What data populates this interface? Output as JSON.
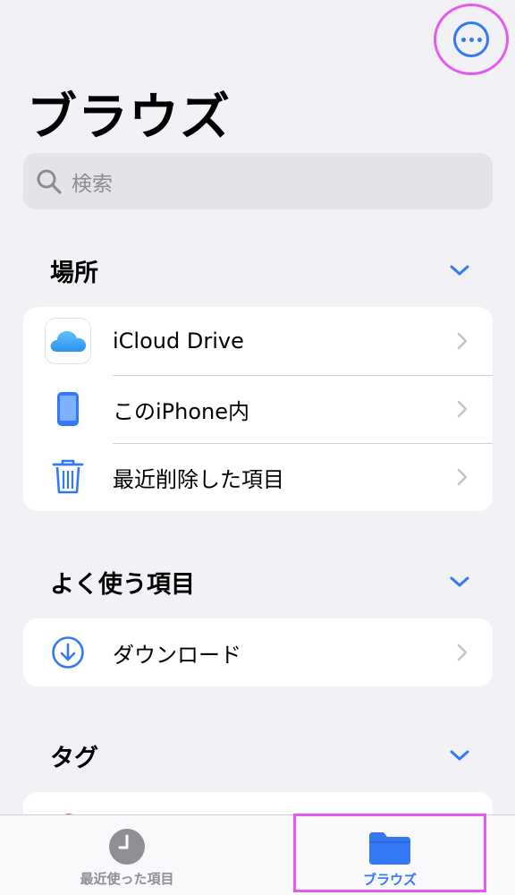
{
  "nav": {
    "title": "ブラウズ",
    "more_icon": "ellipsis-circle-icon"
  },
  "search": {
    "placeholder": "検索",
    "icon": "magnifier-icon"
  },
  "locations": {
    "title": "場所",
    "items": [
      {
        "label": "iCloud Drive",
        "icon": "icloud-icon"
      },
      {
        "label": "このiPhone内",
        "icon": "iphone-icon"
      },
      {
        "label": "最近削除した項目",
        "icon": "trash-icon"
      }
    ]
  },
  "favorites": {
    "title": "よく使う項目",
    "items": [
      {
        "label": "ダウンロード",
        "icon": "download-circle-icon"
      }
    ]
  },
  "tags": {
    "title": "タグ"
  },
  "tabbar": {
    "recent": {
      "label": "最近使った項目",
      "icon": "clock-icon"
    },
    "browse": {
      "label": "ブラウズ",
      "icon": "folder-icon"
    }
  },
  "colors": {
    "accent": "#3478f6",
    "highlight": "#e35bf0",
    "background": "#f2f1f6",
    "inactive": "#8e8e93"
  }
}
